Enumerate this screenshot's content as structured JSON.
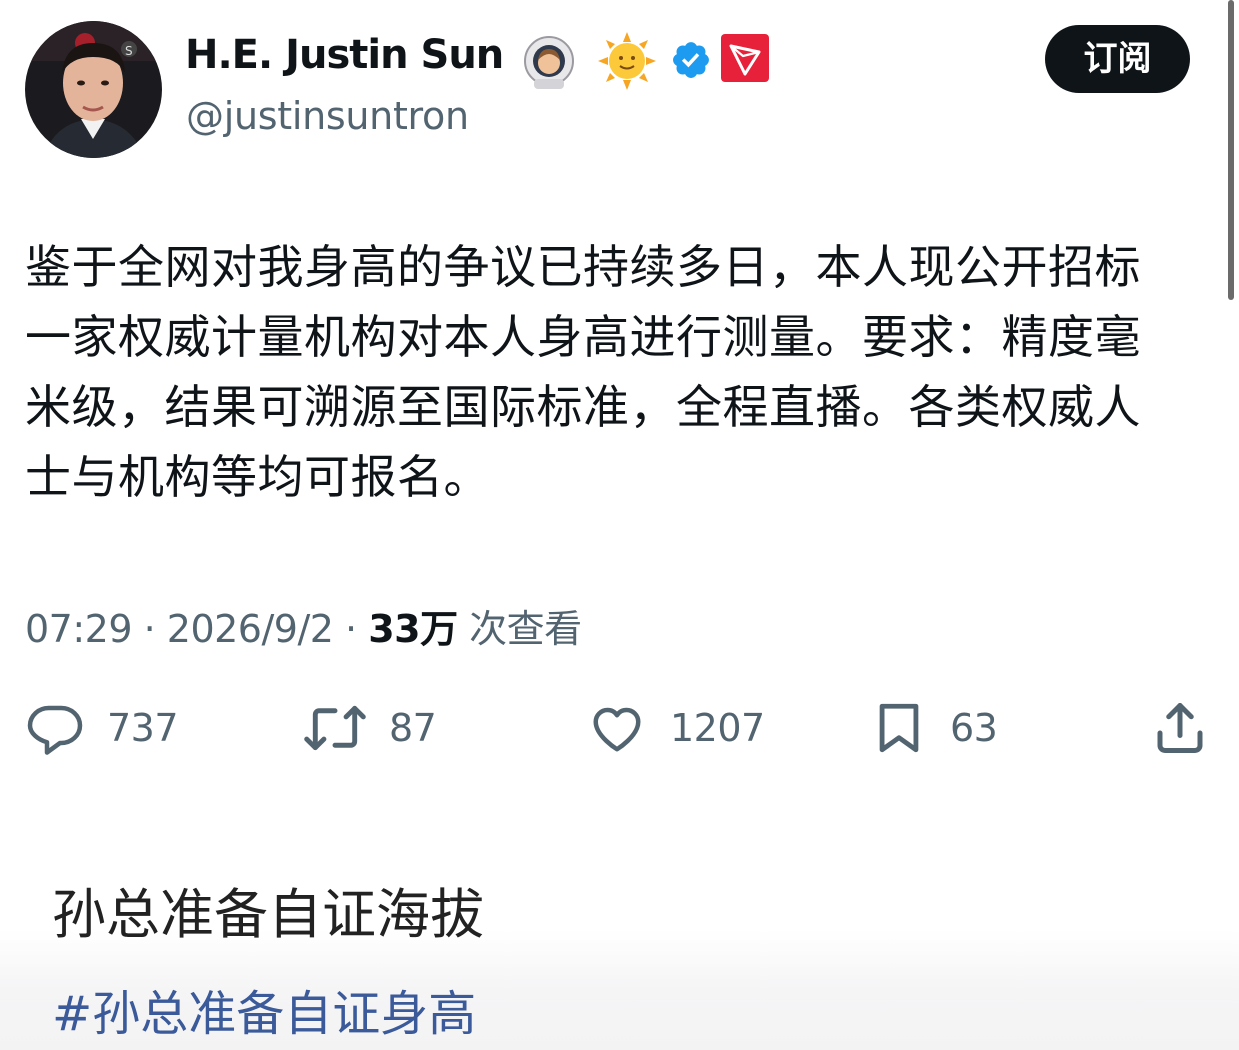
{
  "author": {
    "display_name": "H.E. Justin Sun",
    "handle": "@justinsuntron",
    "badges": [
      "astronaut-emoji-icon",
      "sun-emoji-icon",
      "verified-check-icon",
      "tron-logo-icon"
    ]
  },
  "subscribe_label": "订阅",
  "tweet": {
    "text": "鉴于全网对我身高的争议已持续多日，本人现公开招标一家权威计量机构对本人身高进行测量。要求：精度毫米级，结果可溯源至国际标准，全程直播。各类权威人士与机构等均可报名。",
    "time": "07:29",
    "date": "2026/9/2",
    "views_count": "33万",
    "views_label": "次查看"
  },
  "actions": {
    "replies": "737",
    "reposts": "87",
    "likes": "1207",
    "bookmarks": "63"
  },
  "caption": {
    "title": "孙总准备自证海拔",
    "hashtag": "#孙总准备自证身高"
  },
  "colors": {
    "text_primary": "#0f1419",
    "text_secondary": "#536471",
    "verified_blue": "#1d9bf0",
    "tron_red": "#e8213b",
    "hashtag_blue": "#3b5a9a"
  }
}
